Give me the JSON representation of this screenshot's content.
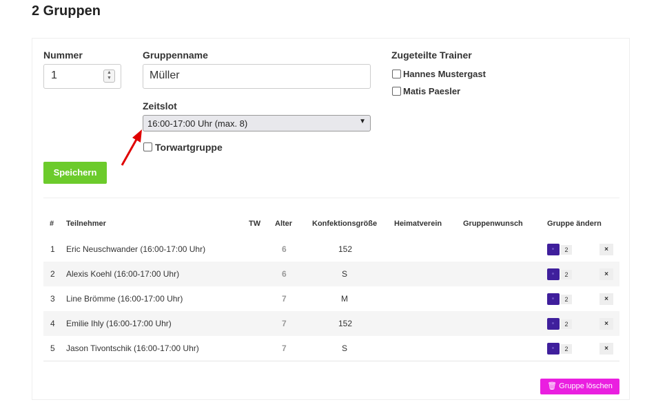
{
  "page": {
    "title": "2 Gruppen"
  },
  "form": {
    "nummer_label": "Nummer",
    "nummer_value": "1",
    "gruppenname_label": "Gruppenname",
    "gruppenname_value": "Müller",
    "zeitslot_label": "Zeitslot",
    "zeitslot_selected": "16:00-17:00 Uhr (max. 8)",
    "torwart_label": "Torwartgruppe",
    "trainer_label": "Zugeteilte Trainer",
    "trainers": [
      "Hannes Mustergast",
      "Matis Paesler"
    ],
    "save_label": "Speichern"
  },
  "table": {
    "headers": [
      "#",
      "Teilnehmer",
      "TW",
      "Alter",
      "Konfektionsgröße",
      "Heimatverein",
      "Gruppenwunsch",
      "Gruppe ändern"
    ],
    "rows": [
      {
        "num": "1",
        "name": "Eric Neuschwander (16:00-17:00 Uhr)",
        "alter": "6",
        "groesse": "152",
        "gruppe": "2"
      },
      {
        "num": "2",
        "name": "Alexis Koehl (16:00-17:00 Uhr)",
        "alter": "6",
        "groesse": "S",
        "gruppe": "2"
      },
      {
        "num": "3",
        "name": "Line Brömme (16:00-17:00 Uhr)",
        "alter": "7",
        "groesse": "M",
        "gruppe": "2"
      },
      {
        "num": "4",
        "name": "Emilie Ihly (16:00-17:00 Uhr)",
        "alter": "7",
        "groesse": "152",
        "gruppe": "2"
      },
      {
        "num": "5",
        "name": "Jason Tivontschik (16:00-17:00 Uhr)",
        "alter": "7",
        "groesse": "S",
        "gruppe": "2"
      }
    ]
  },
  "actions": {
    "delete_label": "🗑 Gruppe löschen"
  },
  "icons": {
    "remove": "×",
    "change_group": "users-icon",
    "trash": "trash-icon"
  },
  "colors": {
    "save": "#6ccb2b",
    "delete": "#ea1fe0",
    "group_button": "#3f1f9c",
    "annotation_arrow": "#e00000"
  }
}
